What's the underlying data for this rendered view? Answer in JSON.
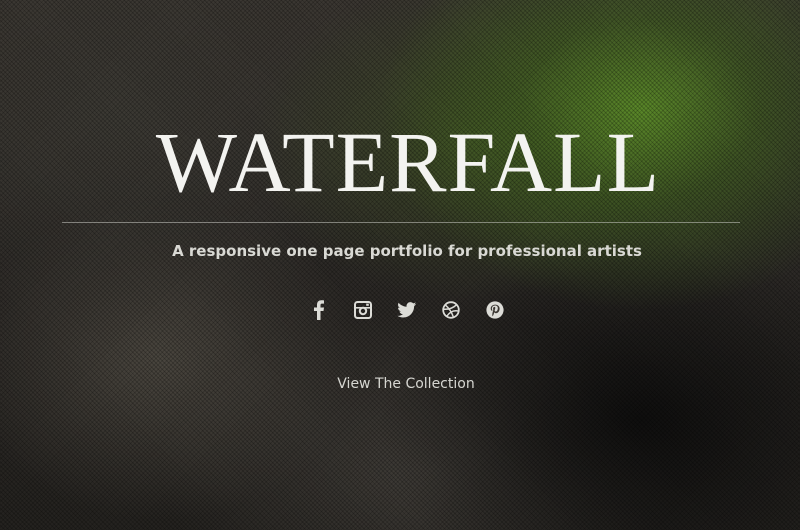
{
  "hero": {
    "title": "WATERFALL",
    "tagline": "A responsive one page portfolio for professional artists",
    "cta_label": "View The Collection"
  },
  "social_links": [
    {
      "icon": "facebook-icon"
    },
    {
      "icon": "instagram-icon"
    },
    {
      "icon": "twitter-icon"
    },
    {
      "icon": "dribbble-icon"
    },
    {
      "icon": "pinterest-icon"
    }
  ],
  "colors": {
    "title": "#f3f3f0",
    "text": "#d9d9d4",
    "background": "#2a2724",
    "foliage_accent": "#60962a"
  }
}
